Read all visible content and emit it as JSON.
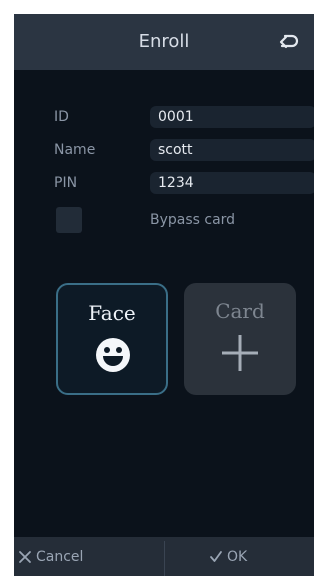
{
  "header": {
    "title": "Enroll",
    "back_icon": "back-arrow-icon"
  },
  "form": {
    "id": {
      "label": "ID",
      "value": "0001"
    },
    "name": {
      "label": "Name",
      "value": "scott"
    },
    "pin": {
      "label": "PIN",
      "value": "1234"
    },
    "bypass": {
      "label": "Bypass card",
      "checked": false
    }
  },
  "tiles": {
    "face": {
      "label": "Face",
      "icon": "smiley-face-icon",
      "selected": true
    },
    "card": {
      "label": "Card",
      "icon": "plus-icon",
      "selected": false
    }
  },
  "bottom": {
    "cancel_label": "Cancel",
    "cancel_icon": "close-icon",
    "ok_label": "OK",
    "ok_icon": "checkmark-icon"
  },
  "colors": {
    "background": "#0b121b",
    "header": "#2b3542",
    "accent_border": "#3a6e87",
    "field": "#1a2430"
  }
}
